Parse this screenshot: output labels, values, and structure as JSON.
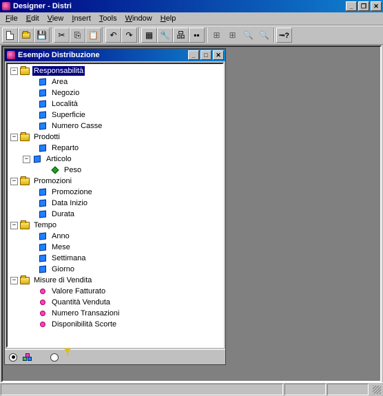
{
  "app": {
    "title": "Designer - Distri",
    "menu": {
      "file": "File",
      "edit": "Edit",
      "view": "View",
      "insert": "Insert",
      "tools": "Tools",
      "window": "Window",
      "help": "Help"
    }
  },
  "toolbar": {
    "new": "new",
    "open": "open",
    "save": "save",
    "cut": "cut",
    "copy": "copy",
    "paste": "paste",
    "undo": "undo",
    "redo": "redo",
    "cube": "schema",
    "wrench": "tools",
    "org": "hierarchy",
    "grid": "align",
    "z1": "zoom-in",
    "z2": "zoom-out",
    "z3": "zoom-fit",
    "z4": "zoom-region",
    "help": "context-help"
  },
  "child": {
    "title": "Esempio Distribuzione"
  },
  "tree": {
    "g1": {
      "label": "Responsabilità",
      "i1": "Area",
      "i2": "Negozio",
      "i3": "Località",
      "i4": "Superficie",
      "i5": "Numero Casse"
    },
    "g2": {
      "label": "Prodotti",
      "i1": "Reparto",
      "i2": "Articolo",
      "i2a": "Peso"
    },
    "g3": {
      "label": "Promozioni",
      "i1": "Promozione",
      "i2": "Data Inizio",
      "i3": "Durata"
    },
    "g4": {
      "label": "Tempo",
      "i1": "Anno",
      "i2": "Mese",
      "i3": "Settimana",
      "i4": "Giorno"
    },
    "g5": {
      "label": "Misure di Vendita",
      "i1": "Valore Fatturato",
      "i2": "Quantità Venduta",
      "i3": "Numero Transazioni",
      "i4": "Disponibilità Scorte"
    }
  },
  "footer": {
    "mode1": "dimensions",
    "mode2": "filter"
  }
}
